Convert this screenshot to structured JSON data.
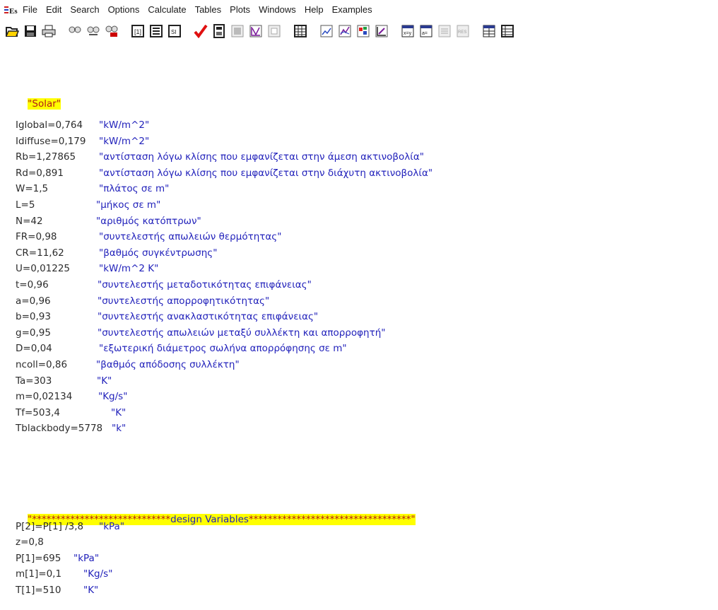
{
  "app": {
    "icon_label": "EES"
  },
  "menu": [
    "File",
    "Edit",
    "Search",
    "Options",
    "Calculate",
    "Tables",
    "Plots",
    "Windows",
    "Help",
    "Examples"
  ],
  "toolbar": [
    "open-icon",
    "save-icon",
    "print-icon",
    "find-icon",
    "find-next-icon",
    "find-replace-icon",
    "info-icon",
    "variable-info-icon",
    "unit-system-icon",
    "check-icon",
    "calculator-icon",
    "solve-icon",
    "min-max-icon",
    "parametric-icon",
    "parametric-table-icon",
    "plot-icon",
    "plot-overlay-icon",
    "plot-3d-icon",
    "plot-edit-icon",
    "equations-window-icon",
    "formatted-equations-icon",
    "solution-window-icon",
    "residuals-icon",
    "arrays-icon",
    "lookup-icon"
  ],
  "editor": {
    "section_title": "\"Solar\"",
    "variables": [
      {
        "eq": "Iglobal=0,764",
        "comment": "\"kW/m^2\""
      },
      {
        "eq": "Idiffuse=0,179",
        "comment": "\"kW/m^2\""
      },
      {
        "eq": "Rb=1,27865",
        "comment": "\"αντίσταση λόγω κλίσης που εμφανίζεται στην άμεση ακτινοβολία\""
      },
      {
        "eq": "Rd=0,891",
        "comment": "\"αντίσταση λόγω κλίσης που εμφανίζεται στην διάχυτη ακτινοβολία\""
      },
      {
        "eq": "W=1,5",
        "comment": "\"πλάτος σε m\""
      },
      {
        "eq": "L=5",
        "comment": "\"μήκος σε m\""
      },
      {
        "eq": "N=42",
        "comment": "\"αριθμός κατόπτρων\""
      },
      {
        "eq": "FR=0,98",
        "comment": "\"συντελεστής απωλειών θερμότητας\""
      },
      {
        "eq": "CR=11,62",
        "comment": "\"βαθμός συγκέντρωσης\""
      },
      {
        "eq": "U=0,01225",
        "comment": "\"kW/m^2 K\""
      },
      {
        "eq": "t=0,96",
        "comment": "\"συντελεστής μεταδοτικότητας επιφάνειας\""
      },
      {
        "eq": "a=0,96",
        "comment": "\"συντελεστής απορροφητικότητας\""
      },
      {
        "eq": "b=0,93",
        "comment": "\"συντελεστής ανακλαστικότητας επιφάνειας\""
      },
      {
        "eq": "g=0,95",
        "comment": "\"συντελεστής απωλειών μεταξύ συλλέκτη και απορροφητή\""
      },
      {
        "eq": "D=0,04",
        "comment": "\"εξωτερική διάμετρος σωλήνα απορρόφησης σε m\""
      },
      {
        "eq": "ncoll=0,86",
        "comment": "\"βαθμός απόδοσης συλλέκτη\""
      },
      {
        "eq": "Ta=303",
        "comment": "\"K\""
      },
      {
        "eq": "m=0,02134",
        "comment": "\"Kg/s\""
      },
      {
        "eq": "Tf=503,4",
        "comment": "\"K\""
      },
      {
        "eq": "Tblackbody=5778",
        "comment": "\"k\""
      }
    ],
    "design_banner": {
      "left": "\"*****************************",
      "middle": "design Variables",
      "right": "**********************************\""
    },
    "design_variables": [
      {
        "eq": "P[2]=P[1] /3,8",
        "comment": "\"kPa\""
      },
      {
        "eq": "z=0,8",
        "comment": ""
      },
      {
        "eq": "P[1]=695",
        "comment": "\"kPa\""
      },
      {
        "eq": "m[1]=0,1",
        "comment": "\"Kg/s\""
      },
      {
        "eq": "T[1]=510",
        "comment": "\"K\""
      }
    ]
  }
}
